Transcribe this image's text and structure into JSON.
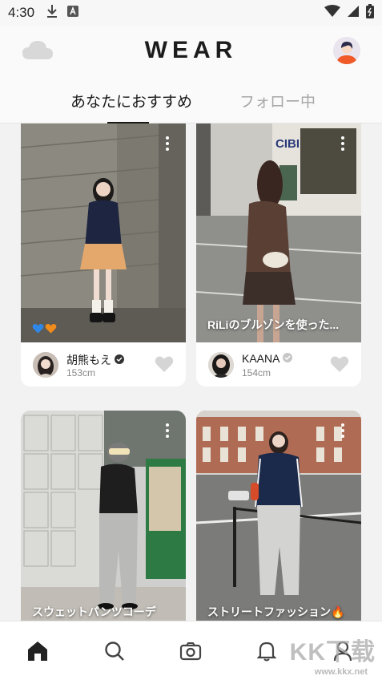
{
  "status_bar": {
    "time": "4:30"
  },
  "header": {
    "logo": "WEAR"
  },
  "tabs": [
    {
      "label": "あなたにおすすめ",
      "active": true
    },
    {
      "label": "フォロー中",
      "active": false
    }
  ],
  "posts": [
    {
      "user": "胡熊もえ",
      "height": "153cm",
      "caption": "",
      "verified": true
    },
    {
      "user": "KAANA",
      "height": "154cm",
      "caption": "RiLiのブルゾンを使った...",
      "verified": true
    },
    {
      "caption": "スウェットパンツコーデ"
    },
    {
      "caption": "ストリートファッション🔥"
    }
  ],
  "bottom_nav": [
    {
      "icon": "home-icon",
      "active": true
    },
    {
      "icon": "search-icon",
      "active": false
    },
    {
      "icon": "camera-icon",
      "active": false
    },
    {
      "icon": "bell-icon",
      "active": false
    },
    {
      "icon": "profile-icon",
      "active": false
    }
  ],
  "watermark": {
    "brand": "KK下载",
    "url": "www.kkx.net"
  },
  "colors": {
    "accent": "#1a1a1a",
    "inactive": "#a7a7a7",
    "like": "#d5d5d5"
  }
}
